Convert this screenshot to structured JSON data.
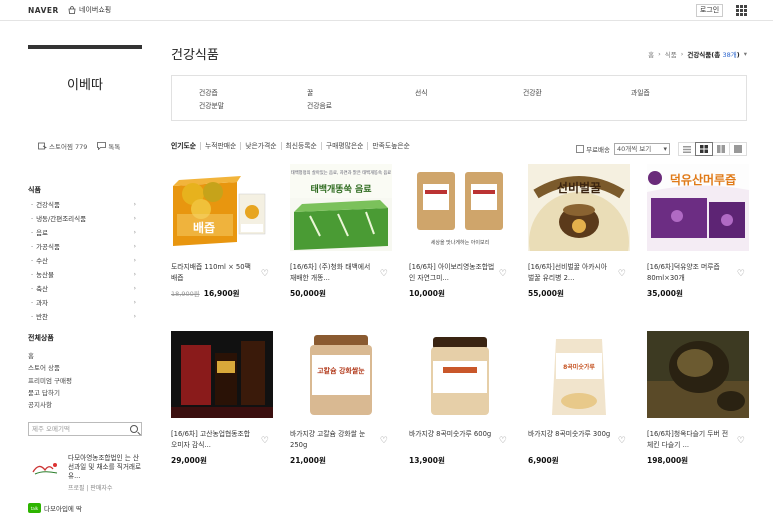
{
  "topbar": {
    "naver": "NAVER",
    "shopping": "네이버쇼핑",
    "login": "로그인"
  },
  "sidebar": {
    "store_name": "이베따",
    "links": [
      {
        "icon": "store-icon",
        "label": "스토어찜 779"
      },
      {
        "icon": "chat-icon",
        "label": "톡톡"
      }
    ],
    "category_title": "식품",
    "categories": [
      "건강식품",
      "냉동/간편조리식품",
      "음료",
      "가공식품",
      "수산",
      "농산물",
      "축산",
      "과자",
      "반찬"
    ],
    "all_title": "전체상품",
    "all_items": [
      "홈",
      "스토어 상품",
      "프리미엄 구매평",
      "묻고 답하기",
      "공지사항"
    ],
    "search_placeholder": "제주 오메기떡",
    "business": {
      "name": "다모아영농조합법인 는 산선과일 및 채소를 직거래로 유...",
      "sub": "프로필 | 판매자수"
    },
    "talk": {
      "badge": "talk",
      "label": "다모아입에 딱"
    }
  },
  "main": {
    "title": "건강식품",
    "breadcrumb": {
      "home": "홈",
      "sep1": "›",
      "level1": "식품",
      "sep2": "›",
      "current": "건강식품",
      "count_prefix": "(총 ",
      "count": "38개",
      "count_suffix": ")"
    },
    "subcategories": [
      "건강즙",
      "꿀",
      "선식",
      "건강환",
      "과일즙",
      "건강분말",
      "건강음료"
    ],
    "sorts": [
      "인기도순",
      "누적판매순",
      "낮은가격순",
      "최신등록순",
      "구매평많은순",
      "만족도높은순"
    ],
    "free_shipping": "무료배송",
    "per_page": "40개씩 보기",
    "products": [
      {
        "name": "도라지배즙 110ml × 50팩 배즙",
        "old_price": "18,900원",
        "price": "16,900원"
      },
      {
        "name": "[16/6차] (주)청화 태백에서 재배한 개똥...",
        "old_price": "",
        "price": "50,000원"
      },
      {
        "name": "[16/6차] 아이보리영농조합법인 자연그미...",
        "old_price": "",
        "price": "10,000원"
      },
      {
        "name": "[16/6차]선비벌꿀 아카시아 벌꿀 유리병 2...",
        "old_price": "",
        "price": "55,000원"
      },
      {
        "name": "[16/6차]덕유양조 머루즙 80ml×30개",
        "old_price": "",
        "price": "35,000원"
      },
      {
        "name": "[16/6차] 고산농업협동조합 오미자 감식...",
        "old_price": "",
        "price": "29,000원"
      },
      {
        "name": "바가지걍 고칼슘 강화쌀 눈 250g",
        "old_price": "",
        "price": "21,000원"
      },
      {
        "name": "바가지걍 8곡미숫가루 600g",
        "old_price": "",
        "price": "13,900원"
      },
      {
        "name": "바가지걍 8곡미숫가루 300g",
        "old_price": "",
        "price": "6,900원"
      },
      {
        "name": "[16/6차]청옥다슬기 두버 전체킨 다슬기 ...",
        "old_price": "",
        "price": "198,000원"
      }
    ],
    "image_texts": {
      "p1": "배즙",
      "p2a": "태백청정의 살아있는 음료, 자연과 맑은 태백개똥숙 음료",
      "p2b": "태백개똥쑥 음료",
      "p3": "세상을 맛나게하는 아이보리",
      "p4": "선비벌꿀",
      "p5": "덕유산머루즙",
      "p7": "고칼슘 강화쌀눈",
      "p9": "8곡미숫가루"
    }
  }
}
